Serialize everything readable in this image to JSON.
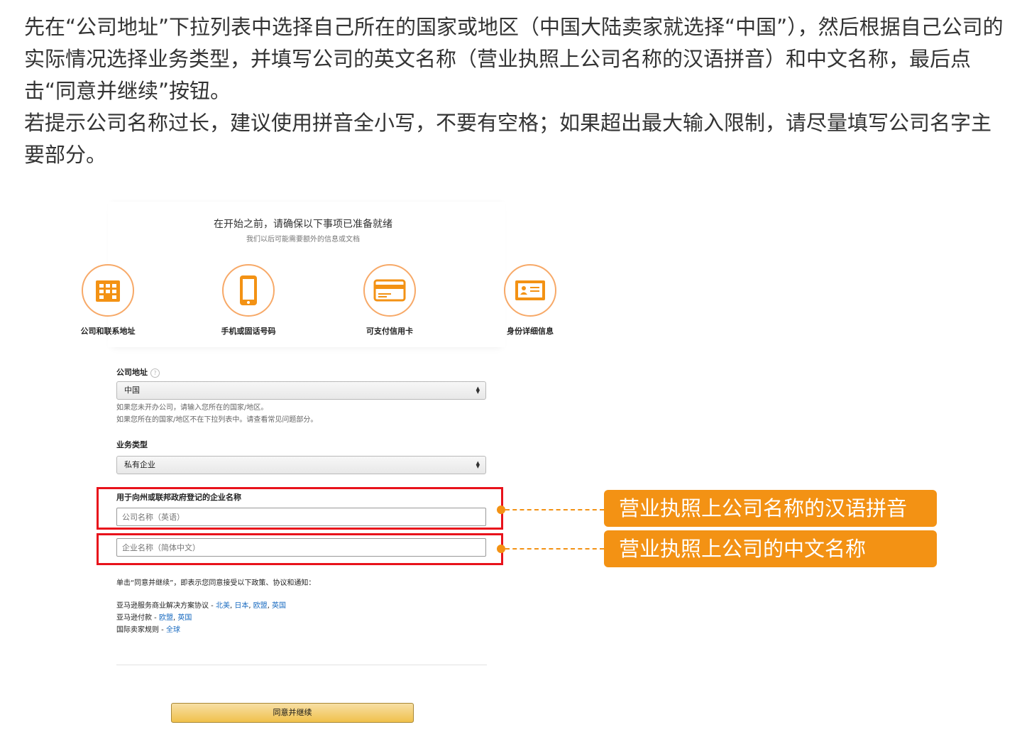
{
  "instructions": {
    "paragraph1": "先在“公司地址”下拉列表中选择自己所在的国家或地区（中国大陆卖家就选择“中国”），然后根据自己公司的实际情况选择业务类型，并填写公司的英文名称（营业执照上公司名称的汉语拼音）和中文名称，最后点击“同意并继续”按钮。",
    "paragraph2": "若提示公司名称过长，建议使用拼音全小写，不要有空格；如果超出最大输入限制，请尽量填写公司名字主要部分。"
  },
  "prep": {
    "title": "在开始之前，请确保以下事项已准备就绪",
    "subtitle": "我们以后可能需要额外的信息或文档",
    "items": [
      {
        "label": "公司和联系地址",
        "icon": "building-icon"
      },
      {
        "label": "手机或固话号码",
        "icon": "phone-icon"
      },
      {
        "label": "可支付信用卡",
        "icon": "credit-card-icon"
      },
      {
        "label": "身份详细信息",
        "icon": "id-card-icon"
      }
    ]
  },
  "form": {
    "address_label": "公司地址",
    "address_help": "?",
    "address_value": "中国",
    "address_hint1": "如果您未开办公司，请输入您所在的国家/地区。",
    "address_hint2": "如果您所在的国家/地区不在下拉列表中。请查看常见问题部分。",
    "business_type_label": "业务类型",
    "business_type_value": "私有企业",
    "company_name_label": "用于向州或联邦政府登记的企业名称",
    "company_name_en_placeholder": "公司名称（英语）",
    "company_name_cn_placeholder": "企业名称（简体中文）",
    "agree_text": "单击“同意并继续”，即表示您同意接受以下政策、协议和通知：",
    "policies": [
      {
        "prefix": "亚马逊服务商业解决方案协议 - ",
        "links": [
          "北美",
          "日本",
          "欧盟",
          "英国"
        ]
      },
      {
        "prefix": "亚马逊付款 - ",
        "links": [
          "欧盟",
          "英国"
        ]
      },
      {
        "prefix": "国际卖家规则 - ",
        "links": [
          "全球"
        ]
      }
    ],
    "continue_label": "同意并继续"
  },
  "callouts": {
    "pinyin": "营业执照上公司名称的汉语拼音",
    "chinese": "营业执照上公司的中文名称"
  },
  "colors": {
    "accent_orange": "#f39214",
    "highlight_red": "#e8121b",
    "icon_orange": "#f7a968",
    "link_blue": "#1a6bc0",
    "button_gold": "#f0c14b"
  }
}
